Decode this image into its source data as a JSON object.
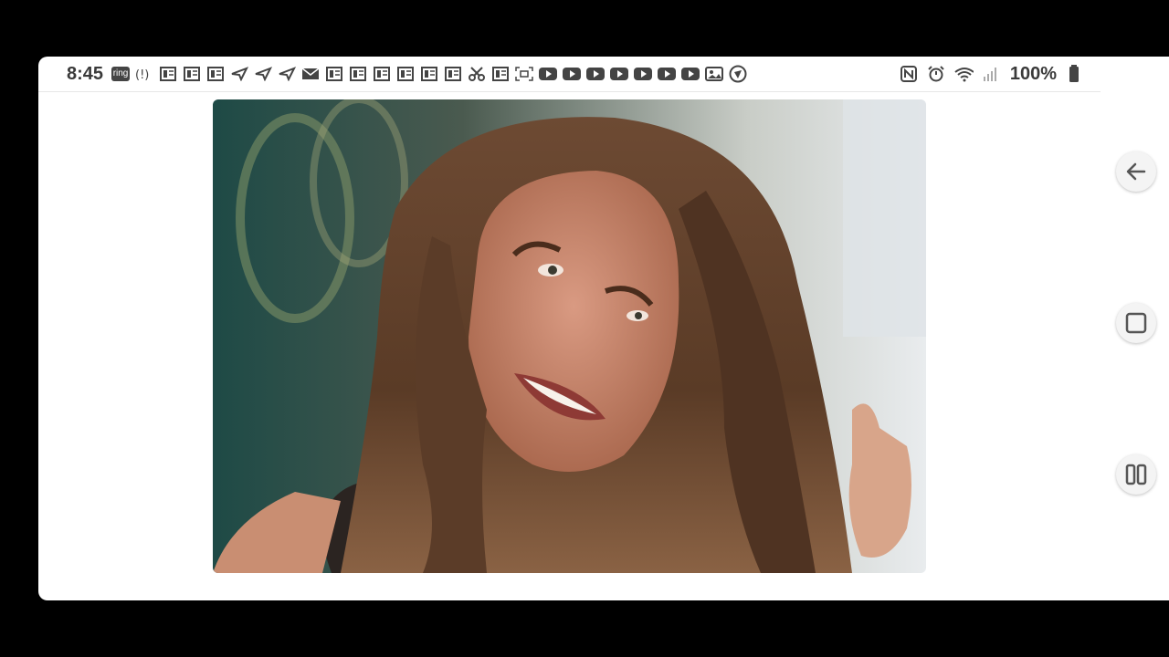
{
  "status_bar": {
    "time": "8:45",
    "ring_badge": "ring",
    "battery_percent": "100%",
    "notification_icons": [
      "ring-app-icon",
      "alert-vibrate-icon",
      "news-icon",
      "news-icon",
      "news-icon",
      "flight-icon",
      "flight-icon",
      "flight-icon",
      "mail-icon",
      "news-icon",
      "news-icon",
      "news-icon",
      "news-icon",
      "news-icon",
      "news-icon",
      "scissors-icon",
      "news-icon",
      "screenshot-icon",
      "youtube-icon",
      "youtube-icon",
      "youtube-icon",
      "youtube-icon",
      "youtube-icon",
      "youtube-icon",
      "youtube-icon",
      "gallery-icon",
      "clock-app-icon"
    ],
    "system_icons": [
      "nfc-icon",
      "alarm-icon",
      "wifi-icon",
      "signal-icon",
      "battery-icon"
    ]
  },
  "content": {
    "photo": "portrait of smiling woman with long brown hair"
  },
  "nav_buttons": [
    "back-arrow-icon",
    "home-square-icon",
    "recent-apps-icon"
  ],
  "colors": {
    "background": "#000000",
    "screen": "#ffffff",
    "icon_gray": "#444444"
  }
}
